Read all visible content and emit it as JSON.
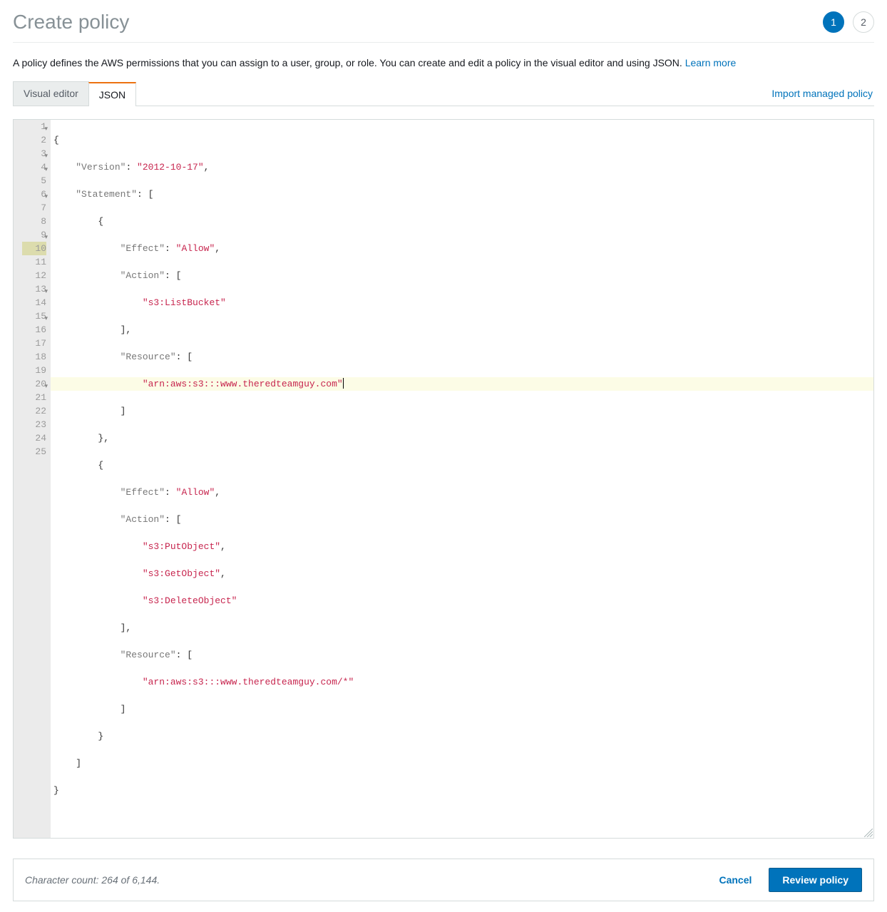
{
  "header": {
    "title": "Create policy",
    "steps": {
      "current": "1",
      "next": "2"
    }
  },
  "description": {
    "text": "A policy defines the AWS permissions that you can assign to a user, group, or role. You can create and edit a policy in the visual editor and using JSON. ",
    "link": "Learn more"
  },
  "tabs": {
    "visual_editor": "Visual editor",
    "json": "JSON"
  },
  "import_link": "Import managed policy",
  "editor": {
    "lines": [
      {
        "n": "1",
        "fold": true
      },
      {
        "n": "2"
      },
      {
        "n": "3",
        "fold": true
      },
      {
        "n": "4",
        "fold": true
      },
      {
        "n": "5"
      },
      {
        "n": "6",
        "fold": true
      },
      {
        "n": "7"
      },
      {
        "n": "8"
      },
      {
        "n": "9",
        "fold": true
      },
      {
        "n": "10",
        "hl": true
      },
      {
        "n": "11"
      },
      {
        "n": "12"
      },
      {
        "n": "13",
        "fold": true
      },
      {
        "n": "14"
      },
      {
        "n": "15",
        "fold": true
      },
      {
        "n": "16"
      },
      {
        "n": "17"
      },
      {
        "n": "18"
      },
      {
        "n": "19"
      },
      {
        "n": "20",
        "fold": true
      },
      {
        "n": "21"
      },
      {
        "n": "22"
      },
      {
        "n": "23"
      },
      {
        "n": "24"
      },
      {
        "n": "25"
      }
    ],
    "code": {
      "version_key": "\"Version\"",
      "version_val": "\"2012-10-17\"",
      "statement_key": "\"Statement\"",
      "effect_key": "\"Effect\"",
      "effect_allow": "\"Allow\"",
      "action_key": "\"Action\"",
      "s3_list": "\"s3:ListBucket\"",
      "resource_key": "\"Resource\"",
      "arn1": "\"arn:aws:s3:::www.theredteamguy.com\"",
      "s3_put": "\"s3:PutObject\"",
      "s3_get": "\"s3:GetObject\"",
      "s3_del": "\"s3:DeleteObject\"",
      "arn2": "\"arn:aws:s3:::www.theredteamguy.com/*\""
    }
  },
  "footer": {
    "char_count": "Character count: 264 of 6,144.",
    "cancel": "Cancel",
    "review": "Review policy"
  }
}
